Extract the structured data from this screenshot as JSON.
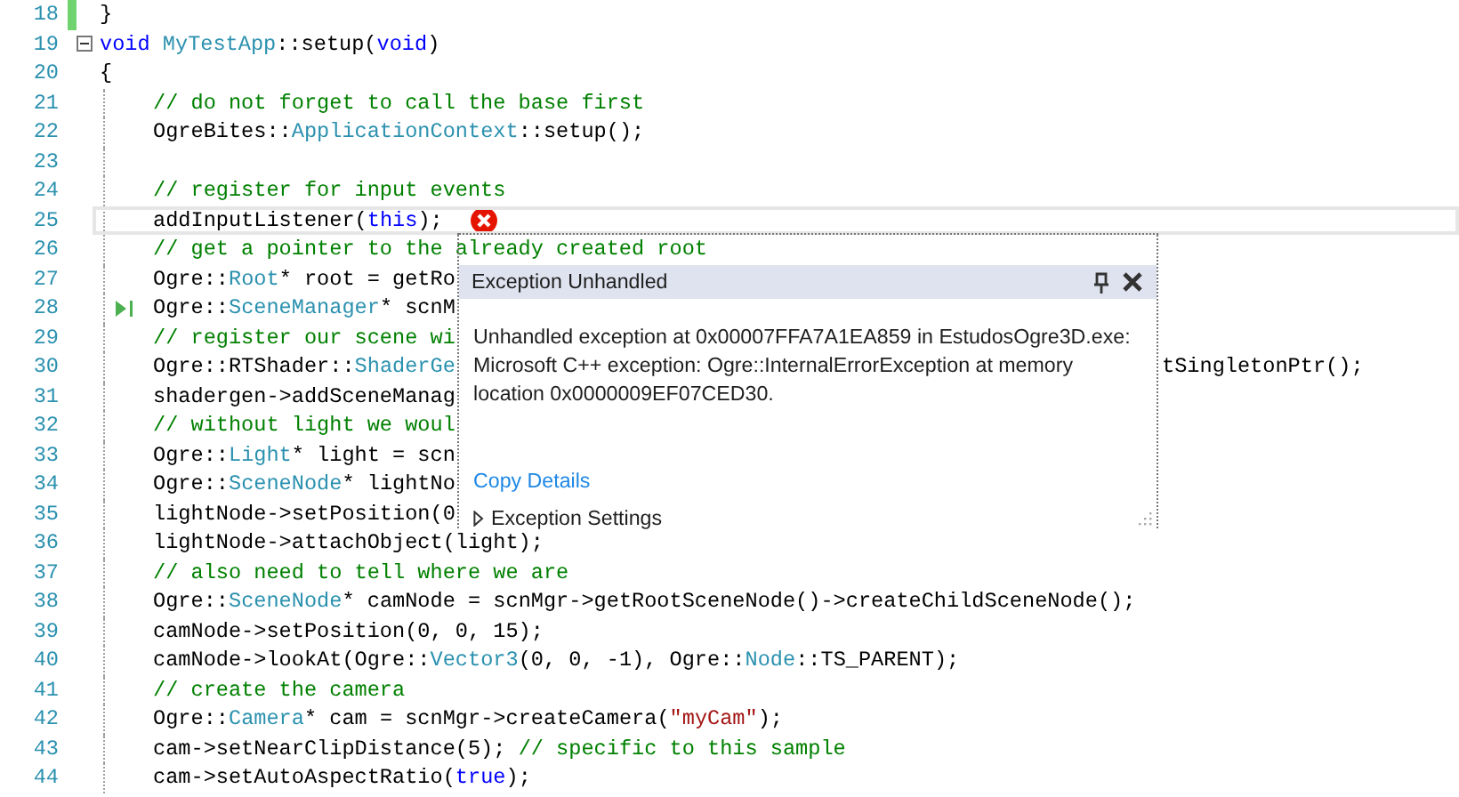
{
  "editor": {
    "lines": [
      {
        "number": "18",
        "indented": false,
        "current": false,
        "foldable": false,
        "next_statement": false,
        "error": false,
        "tokens": [
          {
            "kind": "tx",
            "t": "}"
          }
        ]
      },
      {
        "number": "19",
        "indented": false,
        "current": false,
        "foldable": true,
        "next_statement": false,
        "error": false,
        "tokens": [
          {
            "kind": "kw",
            "t": "void"
          },
          {
            "kind": "type",
            "t": " MyTestApp"
          },
          {
            "kind": "tx",
            "t": "::setup("
          },
          {
            "kind": "kw",
            "t": "void"
          },
          {
            "kind": "tx",
            "t": ")"
          }
        ]
      },
      {
        "number": "20",
        "indented": false,
        "current": false,
        "foldable": false,
        "next_statement": false,
        "error": false,
        "tokens": [
          {
            "kind": "tx",
            "t": "{"
          }
        ]
      },
      {
        "number": "21",
        "indented": true,
        "current": false,
        "foldable": false,
        "next_statement": false,
        "error": false,
        "tokens": [
          {
            "kind": "cm",
            "t": "// do not forget to call the base first"
          }
        ]
      },
      {
        "number": "22",
        "indented": true,
        "current": false,
        "foldable": false,
        "next_statement": false,
        "error": false,
        "tokens": [
          {
            "kind": "tx",
            "t": "OgreBites::"
          },
          {
            "kind": "type",
            "t": "ApplicationContext"
          },
          {
            "kind": "tx",
            "t": "::setup();"
          }
        ]
      },
      {
        "number": "23",
        "indented": true,
        "current": false,
        "foldable": false,
        "next_statement": false,
        "error": false
      },
      {
        "number": "24",
        "indented": true,
        "current": false,
        "foldable": false,
        "next_statement": false,
        "error": false,
        "tokens": [
          {
            "kind": "cm",
            "t": "// register for input events"
          }
        ]
      },
      {
        "number": "25",
        "indented": true,
        "current": true,
        "foldable": false,
        "next_statement": false,
        "error": true,
        "tokens": [
          {
            "kind": "tx",
            "t": "addInputListener("
          },
          {
            "kind": "kw",
            "t": "this"
          },
          {
            "kind": "tx",
            "t": ");"
          }
        ]
      },
      {
        "number": "26",
        "indented": true,
        "current": false,
        "foldable": false,
        "next_statement": false,
        "error": false,
        "tokens": [
          {
            "kind": "cm",
            "t": "// get a pointer to the already created root"
          }
        ]
      },
      {
        "number": "27",
        "indented": true,
        "current": false,
        "foldable": false,
        "next_statement": false,
        "error": false,
        "tokens": [
          {
            "kind": "tx",
            "t": "Ogre::"
          },
          {
            "kind": "type",
            "t": "Root"
          },
          {
            "kind": "tx",
            "t": "* root = getRo"
          }
        ]
      },
      {
        "number": "28",
        "indented": true,
        "current": false,
        "foldable": false,
        "next_statement": true,
        "error": false,
        "tokens": [
          {
            "kind": "tx",
            "t": "Ogre::"
          },
          {
            "kind": "type",
            "t": "SceneManager"
          },
          {
            "kind": "tx",
            "t": "* scnM"
          }
        ]
      },
      {
        "number": "29",
        "indented": true,
        "current": false,
        "foldable": false,
        "next_statement": false,
        "error": false,
        "tokens": [
          {
            "kind": "cm",
            "t": "// register our scene wi"
          }
        ]
      },
      {
        "number": "30",
        "indented": true,
        "current": false,
        "foldable": false,
        "next_statement": false,
        "error": false,
        "tokens": [
          {
            "kind": "tx",
            "t": "Ogre::RTShader::"
          },
          {
            "kind": "type",
            "t": "ShaderGe"
          }
        ],
        "after_popup": [
          {
            "kind": "tx",
            "t": "tSingletonPtr();"
          }
        ]
      },
      {
        "number": "31",
        "indented": true,
        "current": false,
        "foldable": false,
        "next_statement": false,
        "error": false,
        "tokens": [
          {
            "kind": "tx",
            "t": "shadergen->addSceneManag"
          }
        ]
      },
      {
        "number": "32",
        "indented": true,
        "current": false,
        "foldable": false,
        "next_statement": false,
        "error": false,
        "tokens": [
          {
            "kind": "cm",
            "t": "// without light we woul"
          }
        ]
      },
      {
        "number": "33",
        "indented": true,
        "current": false,
        "foldable": false,
        "next_statement": false,
        "error": false,
        "tokens": [
          {
            "kind": "tx",
            "t": "Ogre::"
          },
          {
            "kind": "type",
            "t": "Light"
          },
          {
            "kind": "tx",
            "t": "* light = scn"
          }
        ]
      },
      {
        "number": "34",
        "indented": true,
        "current": false,
        "foldable": false,
        "next_statement": false,
        "error": false,
        "tokens": [
          {
            "kind": "tx",
            "t": "Ogre::"
          },
          {
            "kind": "type",
            "t": "SceneNode"
          },
          {
            "kind": "tx",
            "t": "* lightNo"
          }
        ]
      },
      {
        "number": "35",
        "indented": true,
        "current": false,
        "foldable": false,
        "next_statement": false,
        "error": false,
        "tokens": [
          {
            "kind": "tx",
            "t": "lightNode->setPosition(0"
          }
        ]
      },
      {
        "number": "36",
        "indented": true,
        "current": false,
        "foldable": false,
        "next_statement": false,
        "error": false,
        "tokens": [
          {
            "kind": "tx",
            "t": "lightNode->attachObject(light);"
          }
        ]
      },
      {
        "number": "37",
        "indented": true,
        "current": false,
        "foldable": false,
        "next_statement": false,
        "error": false,
        "tokens": [
          {
            "kind": "cm",
            "t": "// also need to tell where we are"
          }
        ]
      },
      {
        "number": "38",
        "indented": true,
        "current": false,
        "foldable": false,
        "next_statement": false,
        "error": false,
        "tokens": [
          {
            "kind": "tx",
            "t": "Ogre::"
          },
          {
            "kind": "type",
            "t": "SceneNode"
          },
          {
            "kind": "tx",
            "t": "* camNode = scnMgr->getRootSceneNode()->createChildSceneNode();"
          }
        ]
      },
      {
        "number": "39",
        "indented": true,
        "current": false,
        "foldable": false,
        "next_statement": false,
        "error": false,
        "tokens": [
          {
            "kind": "tx",
            "t": "camNode->setPosition(0, 0, 15);"
          }
        ]
      },
      {
        "number": "40",
        "indented": true,
        "current": false,
        "foldable": false,
        "next_statement": false,
        "error": false,
        "tokens": [
          {
            "kind": "tx",
            "t": "camNode->lookAt(Ogre::"
          },
          {
            "kind": "type",
            "t": "Vector3"
          },
          {
            "kind": "tx",
            "t": "(0, 0, -1), Ogre::"
          },
          {
            "kind": "type",
            "t": "Node"
          },
          {
            "kind": "tx",
            "t": "::TS_PARENT);"
          }
        ]
      },
      {
        "number": "41",
        "indented": true,
        "current": false,
        "foldable": false,
        "next_statement": false,
        "error": false,
        "tokens": [
          {
            "kind": "cm",
            "t": "// create the camera"
          }
        ]
      },
      {
        "number": "42",
        "indented": true,
        "current": false,
        "foldable": false,
        "next_statement": false,
        "error": false,
        "tokens": [
          {
            "kind": "tx",
            "t": "Ogre::"
          },
          {
            "kind": "type",
            "t": "Camera"
          },
          {
            "kind": "tx",
            "t": "* cam = scnMgr->createCamera("
          },
          {
            "kind": "str",
            "t": "\"myCam\""
          },
          {
            "kind": "tx",
            "t": ");"
          }
        ]
      },
      {
        "number": "43",
        "indented": true,
        "current": false,
        "foldable": false,
        "next_statement": false,
        "error": false,
        "tokens": [
          {
            "kind": "tx",
            "t": "cam->setNearClipDistance(5); "
          },
          {
            "kind": "cm",
            "t": "// specific to this sample"
          }
        ]
      },
      {
        "number": "44",
        "indented": true,
        "current": false,
        "foldable": false,
        "next_statement": false,
        "error": false,
        "tokens": [
          {
            "kind": "tx",
            "t": "cam->setAutoAspectRatio("
          },
          {
            "kind": "kw",
            "t": "true"
          },
          {
            "kind": "tx",
            "t": ");"
          }
        ]
      }
    ]
  },
  "exception_popup": {
    "title": "Exception Unhandled",
    "message": "Unhandled exception at 0x00007FFA7A1EA859 in EstudosOgre3D.exe: Microsoft C++ exception: Ogre::InternalErrorException at memory location 0x0000009EF07CED30.",
    "link": "Copy Details",
    "settings": {
      "label": "Exception Settings",
      "expanded": false
    }
  }
}
